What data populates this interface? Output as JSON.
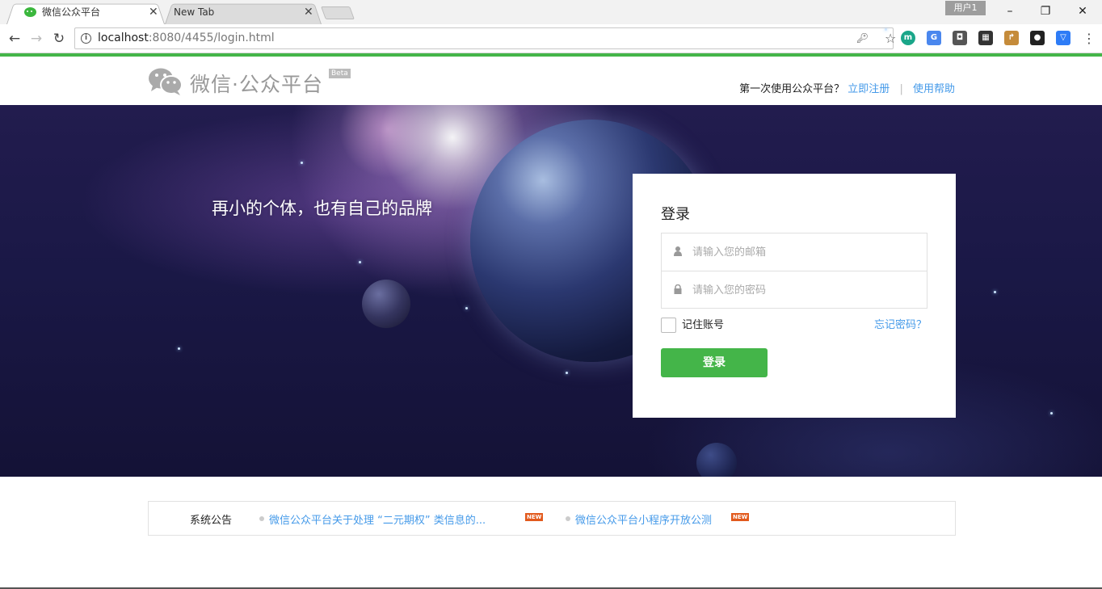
{
  "browser": {
    "tabs": [
      {
        "title": "微信公众平台",
        "active": true
      },
      {
        "title": "New Tab",
        "active": false
      }
    ],
    "profile": "用户1",
    "window_controls": {
      "minimize": "–",
      "restore": "❐",
      "close": "✕"
    },
    "url_host": "localhost",
    "url_rest": ":8080/4455/login.html",
    "extensions": [
      {
        "icon": "m-extension-icon",
        "letter": "m",
        "color": "#1aa689"
      },
      {
        "icon": "translate-icon",
        "letter": "G",
        "color": "#4a87ee"
      },
      {
        "icon": "keep-icon",
        "letter": "◘",
        "color": "#555555"
      },
      {
        "icon": "film-icon",
        "letter": "▦",
        "color": "#333333"
      },
      {
        "icon": "tool-icon",
        "letter": "↱",
        "color": "#c58b3a"
      },
      {
        "icon": "color-wheel-icon",
        "letter": "●",
        "color": "#222222"
      },
      {
        "icon": "shield-icon",
        "letter": "▽",
        "color": "#2e7cf6"
      }
    ],
    "accent": "#44b549"
  },
  "header": {
    "logo_text": "微信·公众平台",
    "beta": "Beta",
    "first_time": "第一次使用公众平台？",
    "register": "立即注册",
    "separator": "|",
    "help": "使用帮助"
  },
  "hero": {
    "slogan": "再小的个体，也有自己的品牌"
  },
  "login": {
    "title": "登录",
    "email_placeholder": "请输入您的邮箱",
    "password_placeholder": "请输入您的密码",
    "remember": "记住账号",
    "forgot": "忘记密码？",
    "submit": "登录"
  },
  "notice": {
    "title": "系统公告",
    "items": [
      {
        "text": "微信公众平台关于处理 “二元期权” 类信息的...",
        "badge": "NEW"
      },
      {
        "text": "微信公众平台小程序开放公测",
        "badge": "NEW"
      }
    ]
  }
}
